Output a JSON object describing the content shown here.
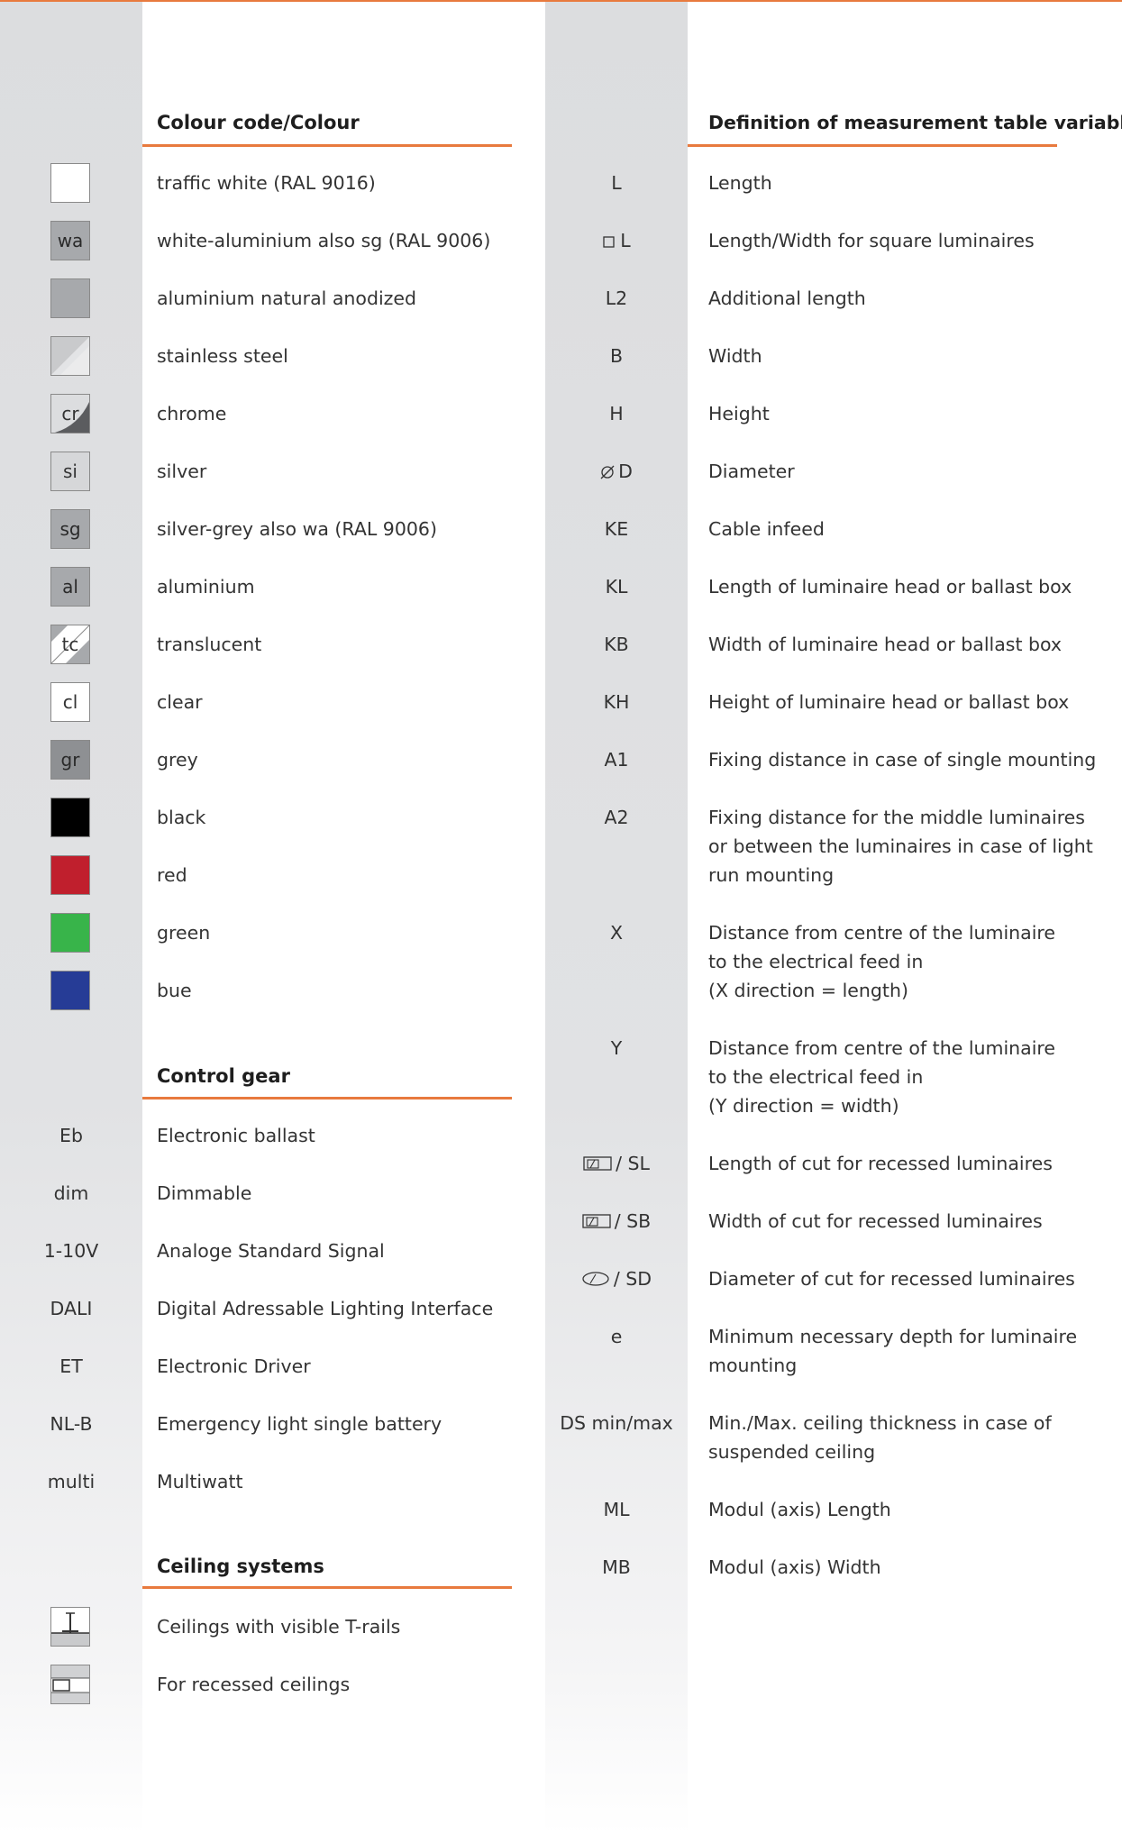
{
  "colours": {
    "heading": "Colour code/Colour",
    "items": [
      {
        "code": "",
        "label": "traffic white (RAL 9016)",
        "fill": "#ffffff"
      },
      {
        "code": "wa",
        "label": "white-aluminium also sg (RAL 9006)",
        "fill": "#a7a9ac"
      },
      {
        "code": "",
        "label": "aluminium natural anodized",
        "fill": "#a7a9ac"
      },
      {
        "code": "",
        "label": "stainless steel",
        "fill": "diag-light"
      },
      {
        "code": "cr",
        "label": "chrome",
        "fill": "diag-dark"
      },
      {
        "code": "si",
        "label": "silver",
        "fill": "#d6d7d9"
      },
      {
        "code": "sg",
        "label": "silver-grey also wa (RAL 9006)",
        "fill": "#a7a9ac"
      },
      {
        "code": "al",
        "label": "aluminium",
        "fill": "#a7a9ac"
      },
      {
        "code": "tc",
        "label": "translucent",
        "fill": "diag-tc"
      },
      {
        "code": "cl",
        "label": "clear",
        "fill": "#ffffff"
      },
      {
        "code": "gr",
        "label": "grey",
        "fill": "#8e9093"
      },
      {
        "code": "",
        "label": "black",
        "fill": "#000000"
      },
      {
        "code": "",
        "label": "red",
        "fill": "#c01f2d"
      },
      {
        "code": "",
        "label": "green",
        "fill": "#38b44a"
      },
      {
        "code": "",
        "label": "bue",
        "fill": "#263c96"
      }
    ]
  },
  "control_gear": {
    "heading": "Control gear",
    "items": [
      {
        "code": "Eb",
        "label": "Electronic ballast"
      },
      {
        "code": "dim",
        "label": "Dimmable"
      },
      {
        "code": "1-10V",
        "label": "Analoge Standard Signal"
      },
      {
        "code": "DALI",
        "label": "Digital Adressable Lighting Interface"
      },
      {
        "code": "ET",
        "label": "Electronic Driver"
      },
      {
        "code": "NL-B",
        "label": "Emergency light single battery"
      },
      {
        "code": "multi",
        "label": "Multiwatt"
      }
    ]
  },
  "ceiling_systems": {
    "heading": "Ceiling systems",
    "items": [
      {
        "icon": "t-rail-ceiling-icon",
        "label": "Ceilings with visible T-rails"
      },
      {
        "icon": "recessed-ceiling-icon",
        "label": "For recessed ceilings"
      }
    ]
  },
  "variables": {
    "heading": "Definition of measurement table variables",
    "items": [
      {
        "symbol": "L",
        "icon": "",
        "lines": [
          "Length"
        ]
      },
      {
        "symbol": "L",
        "icon": "square-icon",
        "lines": [
          "Length/Width for square luminaires"
        ]
      },
      {
        "symbol": "L2",
        "icon": "",
        "lines": [
          "Additional length"
        ]
      },
      {
        "symbol": "B",
        "icon": "",
        "lines": [
          "Width"
        ]
      },
      {
        "symbol": "H",
        "icon": "",
        "lines": [
          "Height"
        ]
      },
      {
        "symbol": "D",
        "icon": "diameter-icon",
        "lines": [
          "Diameter"
        ]
      },
      {
        "symbol": "KE",
        "icon": "",
        "lines": [
          "Cable infeed"
        ]
      },
      {
        "symbol": "KL",
        "icon": "",
        "lines": [
          "Length of luminaire head or ballast box"
        ]
      },
      {
        "symbol": "KB",
        "icon": "",
        "lines": [
          "Width of luminaire head or ballast box"
        ]
      },
      {
        "symbol": "KH",
        "icon": "",
        "lines": [
          "Height of luminaire head or ballast box"
        ]
      },
      {
        "symbol": "A1",
        "icon": "",
        "lines": [
          "Fixing distance in case of single mounting"
        ]
      },
      {
        "symbol": "A2",
        "icon": "",
        "lines": [
          "Fixing distance for the middle luminaires",
          "or between the luminaires in case of light",
          "run mounting"
        ]
      },
      {
        "symbol": "X",
        "icon": "",
        "lines": [
          "Distance from centre of the luminaire",
          "to the electrical feed in",
          "(X direction = length)"
        ]
      },
      {
        "symbol": "Y",
        "icon": "",
        "lines": [
          "Distance from centre of the luminaire",
          "to the electrical feed in",
          "(Y direction = width)"
        ]
      },
      {
        "symbol": "/ SL",
        "icon": "cut-rect-icon",
        "lines": [
          "Length of cut for recessed luminaires"
        ]
      },
      {
        "symbol": "/ SB",
        "icon": "cut-rect-icon",
        "lines": [
          "Width of cut for recessed luminaires"
        ]
      },
      {
        "symbol": "/ SD",
        "icon": "cut-round-icon",
        "lines": [
          "Diameter of cut for recessed luminaires"
        ]
      },
      {
        "symbol": "e",
        "icon": "",
        "lines": [
          "Minimum necessary depth for luminaire",
          "mounting"
        ]
      },
      {
        "symbol": "DS min/max",
        "icon": "",
        "lines": [
          "Min./Max. ceiling thickness in case of",
          "suspended ceiling"
        ]
      },
      {
        "symbol": "ML",
        "icon": "",
        "lines": [
          "Modul (axis) Length"
        ]
      },
      {
        "symbol": "MB",
        "icon": "",
        "lines": [
          "Modul (axis) Width"
        ]
      }
    ]
  }
}
